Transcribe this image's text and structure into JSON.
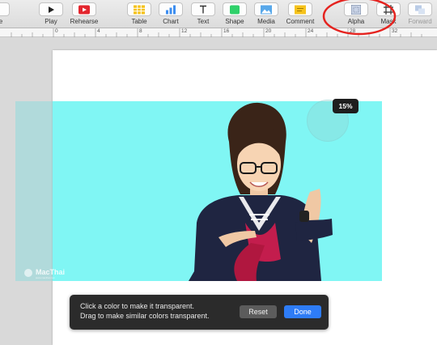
{
  "toolbar": {
    "items": [
      {
        "label": "lide",
        "icon": "slide-icon"
      },
      {
        "label": "Play",
        "icon": "play-icon"
      },
      {
        "label": "Rehearse",
        "icon": "rehearse-icon"
      },
      {
        "label": "Table",
        "icon": "table-icon"
      },
      {
        "label": "Chart",
        "icon": "chart-icon"
      },
      {
        "label": "Text",
        "icon": "text-icon"
      },
      {
        "label": "Shape",
        "icon": "shape-icon"
      },
      {
        "label": "Media",
        "icon": "media-icon"
      },
      {
        "label": "Comment",
        "icon": "comment-icon"
      },
      {
        "label": "Alpha",
        "icon": "alpha-icon"
      },
      {
        "label": "Mask",
        "icon": "mask-icon"
      },
      {
        "label": "Forward",
        "icon": "forward-icon"
      }
    ]
  },
  "ruler": {
    "marks": [
      "0",
      "4",
      "8",
      "12",
      "16",
      "20",
      "24",
      "28",
      "32"
    ]
  },
  "canvas": {
    "zoom_badge": "15%",
    "watermark": {
      "brand": "MacThai",
      "tagline": "www.macthai.com"
    }
  },
  "instructions": {
    "line1": "Click a color to make it transparent.",
    "line2": "Drag to make similar colors transparent.",
    "reset_label": "Reset",
    "done_label": "Done"
  },
  "colors": {
    "accent": "#2e7cf6",
    "photo_background": "#80f6f4",
    "annotation": "#e5231f"
  }
}
